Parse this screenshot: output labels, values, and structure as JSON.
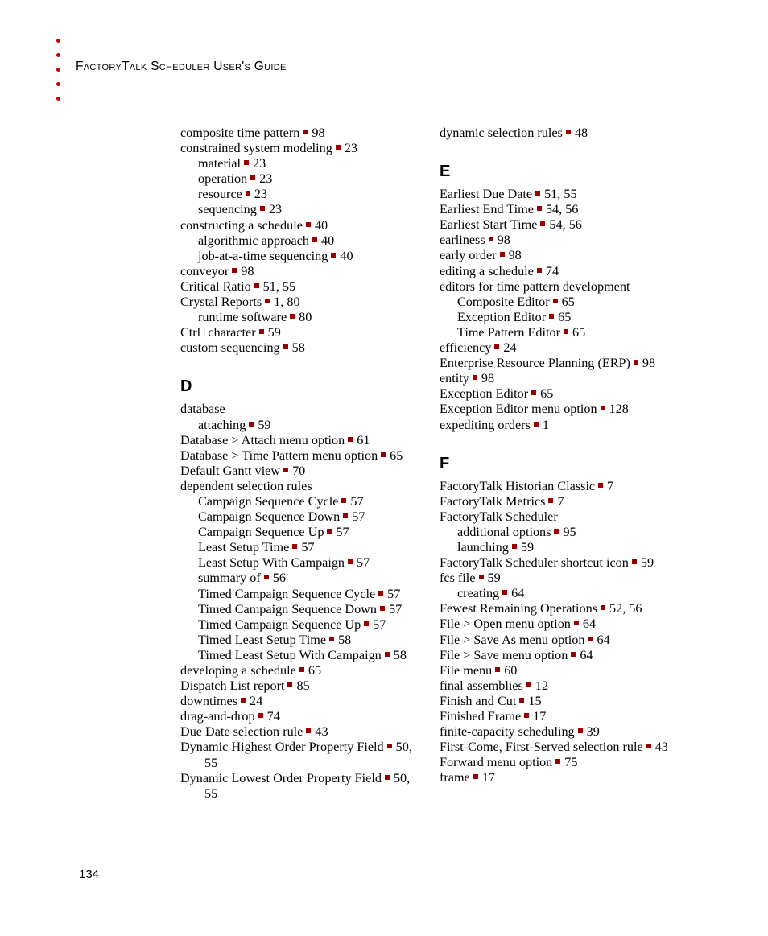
{
  "header": {
    "title": "FactoryTalk Scheduler User's Guide",
    "bullet_count": 5,
    "bullet_color": "#cc0000"
  },
  "separator": {
    "glyph": "square",
    "color": "#990000"
  },
  "footer": {
    "page_number": "134"
  },
  "columns": [
    {
      "name": "left",
      "blocks": [
        {
          "type": "entries",
          "items": [
            {
              "level": 0,
              "text": "composite time pattern",
              "pages": "98"
            },
            {
              "level": 0,
              "text": "constrained system modeling",
              "pages": "23"
            },
            {
              "level": 1,
              "text": "material",
              "pages": "23"
            },
            {
              "level": 1,
              "text": "operation",
              "pages": "23"
            },
            {
              "level": 1,
              "text": "resource",
              "pages": "23"
            },
            {
              "level": 1,
              "text": "sequencing",
              "pages": "23"
            },
            {
              "level": 0,
              "text": "constructing a schedule",
              "pages": "40"
            },
            {
              "level": 1,
              "text": "algorithmic approach",
              "pages": "40"
            },
            {
              "level": 1,
              "text": "job-at-a-time sequencing",
              "pages": "40"
            },
            {
              "level": 0,
              "text": "conveyor",
              "pages": "98"
            },
            {
              "level": 0,
              "text": "Critical Ratio",
              "pages": "51, 55"
            },
            {
              "level": 0,
              "text": "Crystal Reports",
              "pages": "1, 80"
            },
            {
              "level": 1,
              "text": "runtime software",
              "pages": "80"
            },
            {
              "level": 0,
              "text": "Ctrl+character",
              "pages": "59"
            },
            {
              "level": 0,
              "text": "custom sequencing",
              "pages": "58"
            }
          ]
        },
        {
          "type": "letter",
          "letter": "D"
        },
        {
          "type": "entries",
          "items": [
            {
              "level": 0,
              "text": "database",
              "pages": ""
            },
            {
              "level": 1,
              "text": "attaching",
              "pages": "59"
            },
            {
              "level": 0,
              "text": "Database > Attach menu option",
              "pages": "61"
            },
            {
              "level": 0,
              "text": "Database > Time Pattern menu option",
              "pages": "65"
            },
            {
              "level": 0,
              "text": "Default Gantt view",
              "pages": "70"
            },
            {
              "level": 0,
              "text": "dependent selection rules",
              "pages": ""
            },
            {
              "level": 1,
              "text": "Campaign Sequence Cycle",
              "pages": "57"
            },
            {
              "level": 1,
              "text": "Campaign Sequence Down",
              "pages": "57"
            },
            {
              "level": 1,
              "text": "Campaign Sequence Up",
              "pages": "57"
            },
            {
              "level": 1,
              "text": "Least Setup Time",
              "pages": "57"
            },
            {
              "level": 1,
              "text": "Least Setup With Campaign",
              "pages": "57"
            },
            {
              "level": 1,
              "text": "summary of",
              "pages": "56"
            },
            {
              "level": 1,
              "text": "Timed Campaign Sequence Cycle",
              "pages": "57"
            },
            {
              "level": 1,
              "text": "Timed Campaign Sequence Down",
              "pages": "57"
            },
            {
              "level": 1,
              "text": "Timed Campaign Sequence Up",
              "pages": "57"
            },
            {
              "level": 1,
              "text": "Timed Least Setup Time",
              "pages": "58"
            },
            {
              "level": 1,
              "text": "Timed Least Setup With Campaign",
              "pages": "58"
            },
            {
              "level": 0,
              "text": "developing a schedule",
              "pages": "65"
            },
            {
              "level": 0,
              "text": "Dispatch List report",
              "pages": "85"
            },
            {
              "level": 0,
              "text": "downtimes",
              "pages": "24"
            },
            {
              "level": 0,
              "text": "drag-and-drop",
              "pages": "74"
            },
            {
              "level": 0,
              "text": "Due Date selection rule",
              "pages": "43"
            },
            {
              "level": 0,
              "text": "Dynamic Highest Order Property Field",
              "pages": "50, 55"
            },
            {
              "level": 0,
              "text": "Dynamic Lowest Order Property Field",
              "pages": "50, 55"
            }
          ]
        }
      ]
    },
    {
      "name": "right",
      "blocks": [
        {
          "type": "entries",
          "items": [
            {
              "level": 0,
              "text": "dynamic selection rules",
              "pages": "48"
            }
          ]
        },
        {
          "type": "letter",
          "letter": "E"
        },
        {
          "type": "entries",
          "items": [
            {
              "level": 0,
              "text": "Earliest Due Date",
              "pages": "51, 55"
            },
            {
              "level": 0,
              "text": "Earliest End Time",
              "pages": "54, 56"
            },
            {
              "level": 0,
              "text": "Earliest Start Time",
              "pages": "54, 56"
            },
            {
              "level": 0,
              "text": "earliness",
              "pages": "98"
            },
            {
              "level": 0,
              "text": "early order",
              "pages": "98"
            },
            {
              "level": 0,
              "text": "editing a schedule",
              "pages": "74"
            },
            {
              "level": 0,
              "text": "editors for time pattern development",
              "pages": ""
            },
            {
              "level": 1,
              "text": "Composite Editor",
              "pages": "65"
            },
            {
              "level": 1,
              "text": "Exception Editor",
              "pages": "65"
            },
            {
              "level": 1,
              "text": "Time Pattern Editor",
              "pages": "65"
            },
            {
              "level": 0,
              "text": "efficiency",
              "pages": "24"
            },
            {
              "level": 0,
              "text": "Enterprise Resource Planning (ERP)",
              "pages": "98"
            },
            {
              "level": 0,
              "text": "entity",
              "pages": "98"
            },
            {
              "level": 0,
              "text": "Exception Editor",
              "pages": "65"
            },
            {
              "level": 0,
              "text": "Exception Editor menu option",
              "pages": "128"
            },
            {
              "level": 0,
              "text": "expediting orders",
              "pages": "1"
            }
          ]
        },
        {
          "type": "letter",
          "letter": "F"
        },
        {
          "type": "entries",
          "items": [
            {
              "level": 0,
              "text": "FactoryTalk Historian Classic",
              "pages": "7"
            },
            {
              "level": 0,
              "text": "FactoryTalk Metrics",
              "pages": "7"
            },
            {
              "level": 0,
              "text": "FactoryTalk Scheduler",
              "pages": ""
            },
            {
              "level": 1,
              "text": "additional options",
              "pages": "95"
            },
            {
              "level": 1,
              "text": "launching",
              "pages": "59"
            },
            {
              "level": 0,
              "text": "FactoryTalk Scheduler shortcut icon",
              "pages": "59"
            },
            {
              "level": 0,
              "text": "fcs file",
              "pages": "59"
            },
            {
              "level": 1,
              "text": "creating",
              "pages": "64"
            },
            {
              "level": 0,
              "text": "Fewest Remaining Operations",
              "pages": "52, 56"
            },
            {
              "level": 0,
              "text": "File > Open menu option",
              "pages": "64"
            },
            {
              "level": 0,
              "text": "File > Save As menu option",
              "pages": "64"
            },
            {
              "level": 0,
              "text": "File > Save menu option",
              "pages": "64"
            },
            {
              "level": 0,
              "text": "File menu",
              "pages": "60"
            },
            {
              "level": 0,
              "text": "final assemblies",
              "pages": "12"
            },
            {
              "level": 0,
              "text": "Finish and Cut",
              "pages": "15"
            },
            {
              "level": 0,
              "text": "Finished Frame",
              "pages": "17"
            },
            {
              "level": 0,
              "text": "finite-capacity scheduling",
              "pages": "39"
            },
            {
              "level": 0,
              "text": "First-Come, First-Served selection rule",
              "pages": "43"
            },
            {
              "level": 0,
              "text": "Forward menu option",
              "pages": "75"
            },
            {
              "level": 0,
              "text": "frame",
              "pages": "17"
            }
          ]
        }
      ]
    }
  ]
}
